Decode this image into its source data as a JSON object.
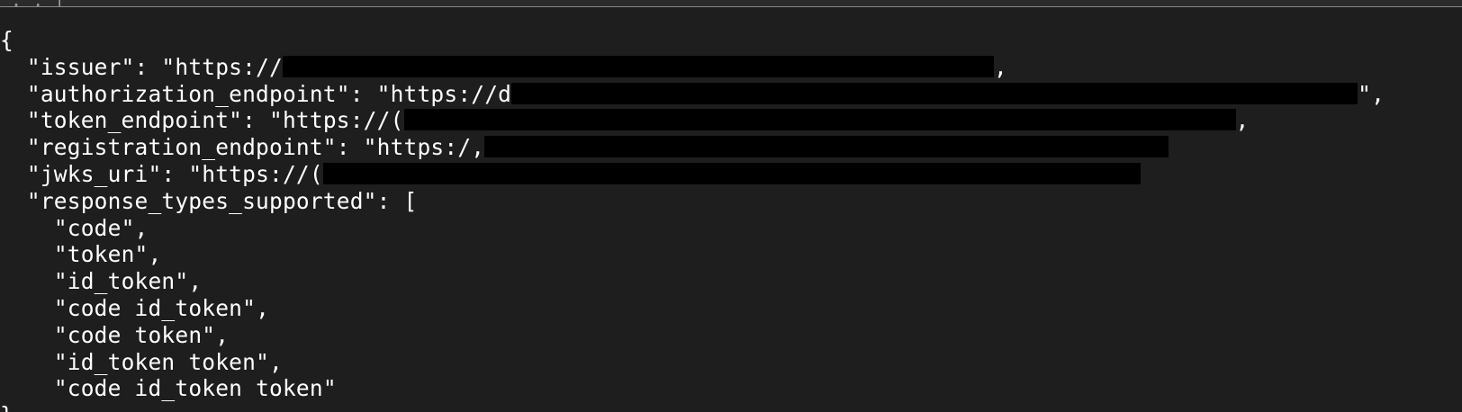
{
  "window": {
    "title_fragment": ". ; |"
  },
  "json_output": {
    "open_brace": "{",
    "close_brace": "}",
    "issuer": {
      "key": "\"issuer\"",
      "prefix": "\"https://",
      "suffix": ","
    },
    "authorization_endpoint": {
      "key": "\"authorization_endpoint\"",
      "prefix": "\"https://d",
      "suffix": "\","
    },
    "token_endpoint": {
      "key": "\"token_endpoint\"",
      "prefix": "\"https://(",
      "suffix": ","
    },
    "registration_endpoint": {
      "key": "\"registration_endpoint\"",
      "prefix": "\"https:/,",
      "suffix": ""
    },
    "jwks_uri": {
      "key": "\"jwks_uri\"",
      "prefix": "\"https://(",
      "suffix": ""
    },
    "response_types_supported": {
      "key": "\"response_types_supported\"",
      "open": "[",
      "items": [
        "\"code\",",
        "\"token\",",
        "\"id_token\",",
        "\"code id_token\",",
        "\"code token\",",
        "\"id_token token\",",
        "\"code id_token token\""
      ]
    }
  }
}
